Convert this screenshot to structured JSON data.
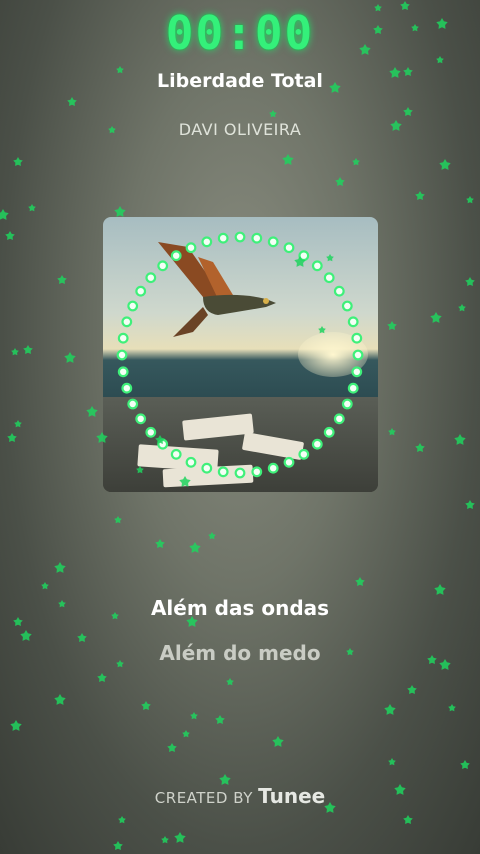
{
  "clock": {
    "time": "00:00",
    "color": "#34f07a"
  },
  "song": {
    "title": "Liberdade Total",
    "artist": "DAVI OLIVEIRA"
  },
  "lyrics": {
    "current": "Além das ondas",
    "next": "Além do medo"
  },
  "footer": {
    "created_by": "CREATED BY",
    "brand": "Tunee"
  },
  "visualizer": {
    "style": "dotted-ring",
    "color": "#3ff07a"
  },
  "particles": {
    "icon": "star-icon",
    "color": "#1fd45e"
  }
}
